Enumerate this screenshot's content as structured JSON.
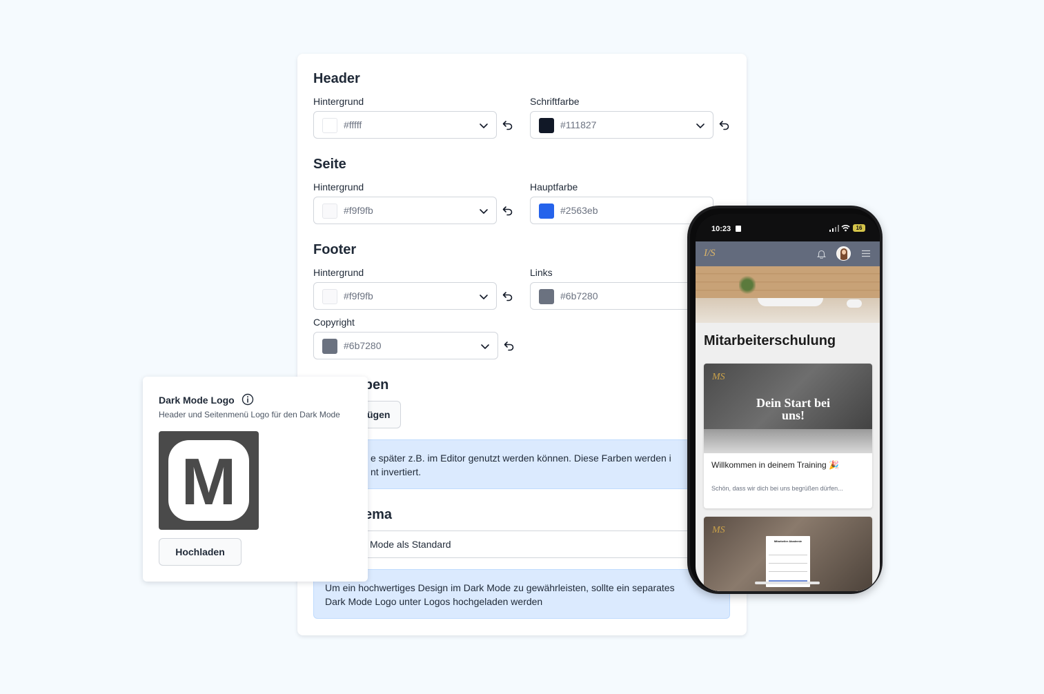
{
  "settings": {
    "header": {
      "title": "Header",
      "background": {
        "label": "Hintergrund",
        "value": "#fffff",
        "swatch": "#ffffff"
      },
      "font_color": {
        "label": "Schriftfarbe",
        "value": "#111827",
        "swatch": "#111827"
      }
    },
    "page": {
      "title": "Seite",
      "background": {
        "label": "Hintergrund",
        "value": "#f9f9fb",
        "swatch": "#f9f9fb"
      },
      "main_color": {
        "label": "Hauptfarbe",
        "value": "#2563eb",
        "swatch": "#2563eb"
      }
    },
    "footer": {
      "title": "Footer",
      "background": {
        "label": "Hintergrund",
        "value": "#f9f9fb",
        "swatch": "#f9f9fb"
      },
      "links": {
        "label": "Links",
        "value": "#6b7280",
        "swatch": "#6b7280"
      },
      "copyright": {
        "label": "Copyright",
        "value": "#6b7280",
        "swatch": "#6b7280"
      }
    },
    "colors_section": {
      "title_partial": "rben",
      "add_button_partial": "ügen",
      "info_line1": "e später z.B. im Editor genutzt werden können. Diese Farben werden i",
      "info_line2": "nt invertiert."
    },
    "theme_section": {
      "title_partial": "ema",
      "select_partial": "Mode als Standard"
    },
    "dark_mode_info": {
      "line1": "Um ein hochwertiges Design im Dark Mode zu gewährleisten, sollte ein separates",
      "line2": "Dark Mode Logo unter Logos hochgeladen werden"
    }
  },
  "dark_mode_logo": {
    "title": "Dark Mode Logo",
    "subtitle": "Header und Seitenmenü Logo für den Dark Mode",
    "logo_letter": "M",
    "upload_label": "Hochladen"
  },
  "phone": {
    "time": "10:23",
    "battery": "16",
    "logo_text": "I/S",
    "page_title": "Mitarbeiterschulung",
    "courses": [
      {
        "brand": "MS",
        "image_title": "Dein Start bei uns!",
        "name": "Willkommen in deinem Training 🎉",
        "description": "Schön, dass wir dich bei uns begrüßen dürfen..."
      },
      {
        "brand": "MS",
        "login_heading": "Mitarbeiter Akademie"
      }
    ]
  }
}
